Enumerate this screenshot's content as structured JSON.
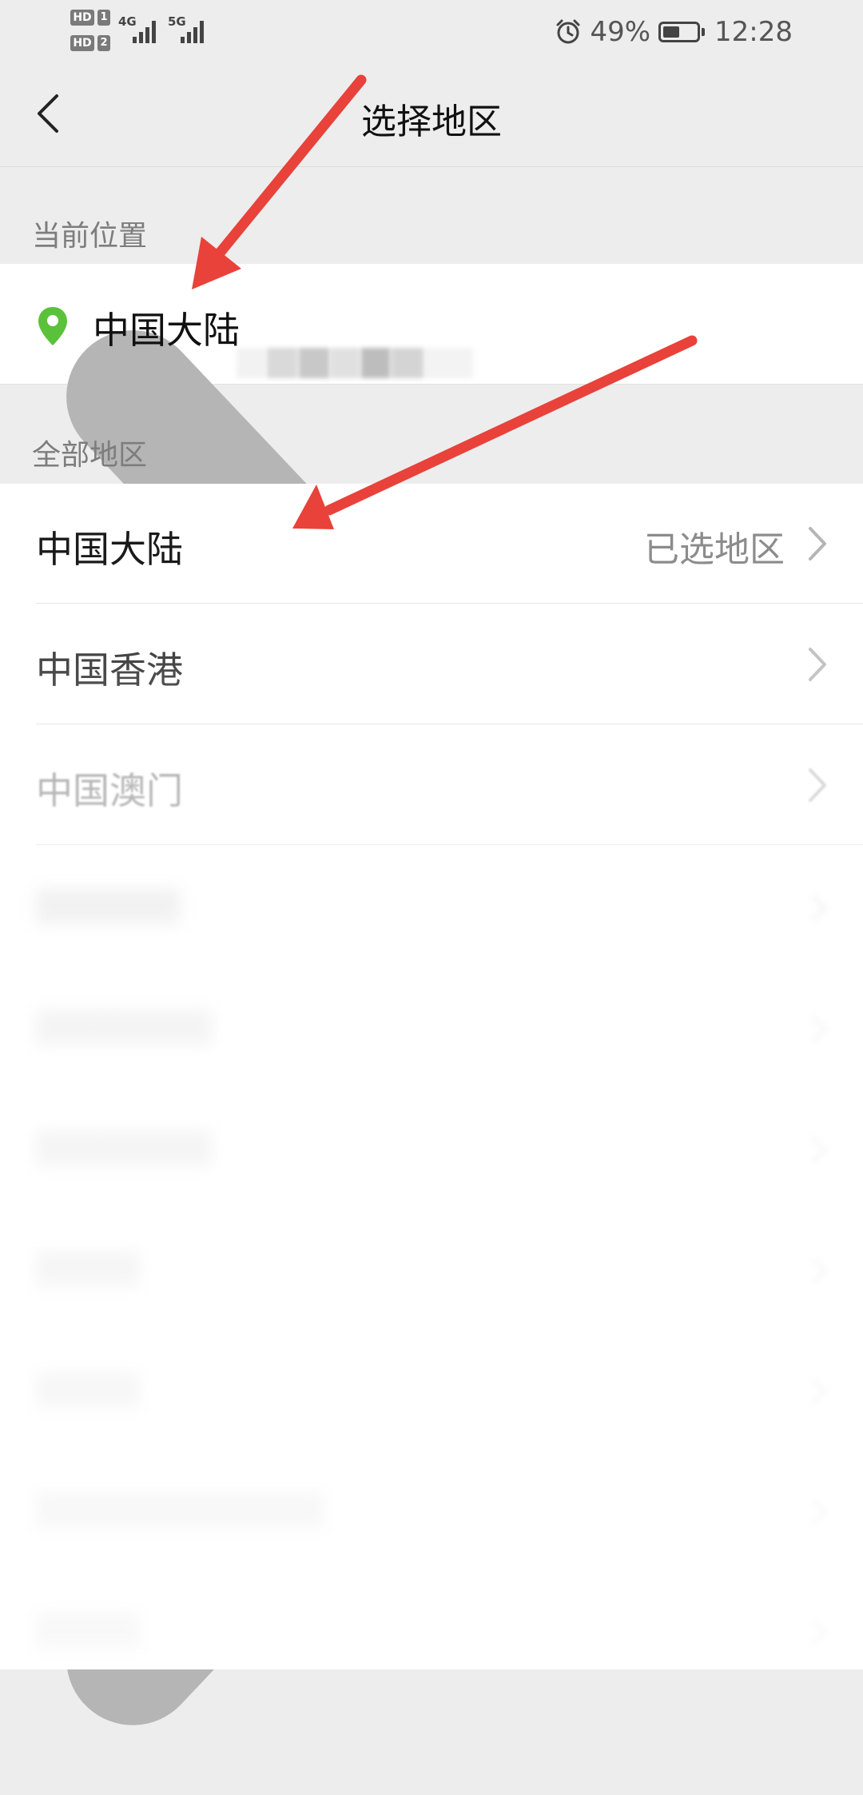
{
  "status_bar": {
    "hd1": "HD",
    "sim1": "1",
    "hd2": "HD",
    "sim2": "2",
    "net1": "4G",
    "net2": "5G",
    "battery_percent": "49%",
    "battery_level": 0.49,
    "time": "12:28"
  },
  "header": {
    "title": "选择地区"
  },
  "current_location": {
    "label": "当前位置",
    "value": "中国大陆"
  },
  "all_regions": {
    "label": "全部地区",
    "items": [
      {
        "name": "中国大陆",
        "note": "已选地区"
      },
      {
        "name": "中国香港"
      },
      {
        "name": "中国澳门"
      }
    ]
  },
  "colors": {
    "accent_green": "#5ac23a",
    "annotation_red": "#e8423a",
    "background": "#ededed"
  },
  "icons": [
    "back-arrow-icon",
    "location-pin-icon",
    "chevron-right-icon",
    "alarm-icon",
    "battery-icon",
    "signal-icon"
  ]
}
